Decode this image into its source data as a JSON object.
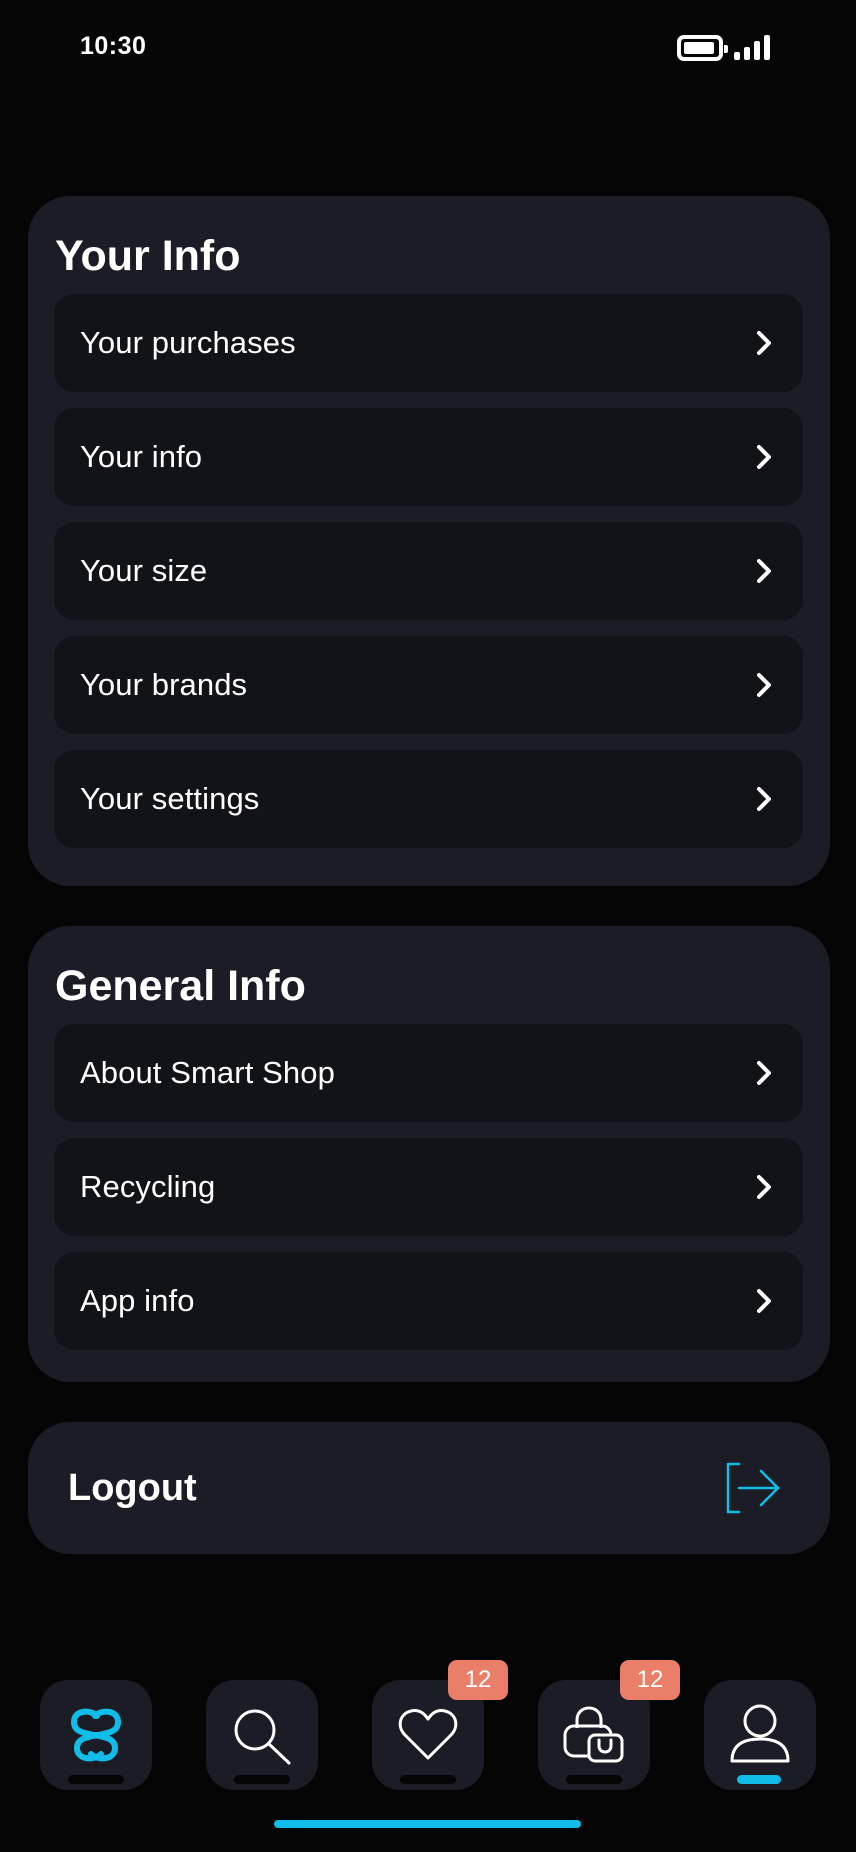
{
  "status_bar": {
    "time": "10:30",
    "icons": [
      "battery-icon",
      "signal-icon"
    ]
  },
  "your_info": {
    "title": "Your Info",
    "items": [
      {
        "label": "Your purchases",
        "icon": "chevron-right-icon"
      },
      {
        "label": "Your info",
        "icon": "chevron-right-icon"
      },
      {
        "label": "Your size",
        "icon": "chevron-right-icon"
      },
      {
        "label": "Your brands",
        "icon": "chevron-right-icon"
      },
      {
        "label": "Your settings",
        "icon": "chevron-right-icon"
      }
    ]
  },
  "general_info": {
    "title": "General Info",
    "items": [
      {
        "label": "About Smart Shop",
        "icon": "chevron-right-icon"
      },
      {
        "label": "Recycling",
        "icon": "chevron-right-icon"
      },
      {
        "label": "App info",
        "icon": "chevron-right-icon"
      }
    ]
  },
  "logout": {
    "label": "Logout",
    "icon": "logout-icon"
  },
  "tab_bar": {
    "tabs": [
      {
        "icon": "smart-shop-logo-icon",
        "active": false
      },
      {
        "icon": "search-icon",
        "active": false
      },
      {
        "icon": "heart-icon",
        "active": false,
        "badge": "12"
      },
      {
        "icon": "shopping-bag-icon",
        "active": false,
        "badge": "12"
      },
      {
        "icon": "profile-icon",
        "active": true
      }
    ]
  },
  "colors": {
    "background": "#050505",
    "card": "#1b1c26",
    "menu_item": "#121319",
    "accent": "#0fbde8",
    "badge": "#ea7e69",
    "text": "#ffffff"
  }
}
